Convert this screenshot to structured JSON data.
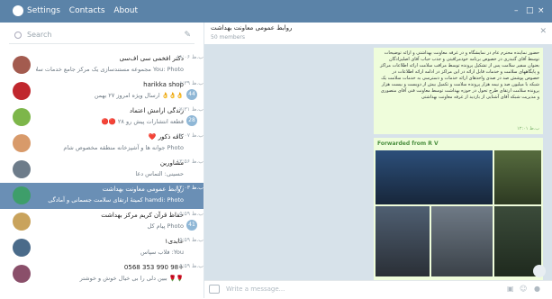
{
  "menu": [
    "Settings",
    "Contacts",
    "About"
  ],
  "window_controls": [
    "–",
    "□",
    "×"
  ],
  "search": {
    "placeholder": "Search"
  },
  "chats": [
    {
      "title": "دکتر افخمی سی اف‌سی",
      "preview": "You: Photo مجموعه مستندسازی یک مرکز جامع خدمات سلامت",
      "time": "۱۸:۰۶ ب.ظ",
      "badge": "",
      "avatar_color": "#a35b4f",
      "active": false
    },
    {
      "title": "harikka shop",
      "preview": "👌👌👌 ارسال ویژه امروز ۲۷ بهمن",
      "time": "۰۸:۳۹ ب.ظ",
      "badge": "44",
      "avatar_color": "#c0272d",
      "active": false
    },
    {
      "title": "زندگی ارامش اعتماد",
      "preview": "قطعه انتشارات پیش رو ۲۸ 🔴🔴",
      "time": "۰۷:۳۱ ب.ظ",
      "badge": "28",
      "avatar_color": "#7db64a",
      "active": false
    },
    {
      "title": "کافه ذکور ❤️",
      "preview": "Photo جوانه ها و آشپزخانه منطقه مخصوص شام",
      "time": "۱۸:۰۷ ب.ظ",
      "badge": "",
      "avatar_color": "#d89a6a",
      "active": false
    },
    {
      "title": "مشاورین",
      "preview": "حسینی: التماس دعا",
      "time": "۱۳:۵۶ ب.ظ",
      "badge": "",
      "avatar_color": "#6d7c8a",
      "active": false
    },
    {
      "title": "روابط عمومی معاونت بهداشت",
      "preview": "hamdi: Photo کمیتهٔ ارتقای سلامت جسمانی و آمادگی",
      "time": "۱۲:۰۳ ب.ظ",
      "badge": "",
      "avatar_color": "#3e9e6a",
      "active": true
    },
    {
      "title": "حفاظ قرآن کریم مرکز بهداشت",
      "preview": "Photo پیام کل",
      "time": "۰۵:۵۹ ب.ظ",
      "badge": "41",
      "avatar_color": "#c9a35c",
      "active": false
    },
    {
      "title": "عابدی۱",
      "preview": "You: فلاب سپاس",
      "time": "۰۵:۵۹ ب.ظ",
      "badge": "",
      "avatar_color": "#4a6b8a",
      "active": false
    },
    {
      "title": "+98 990 353 0568",
      "preview": "🌹🌹 ببین دلی را بی خیال خوش و خوشتر",
      "time": "۰۵:۵۹ ب.ظ",
      "badge": "",
      "avatar_color": "#8a4f6a",
      "active": false
    }
  ],
  "header": {
    "title": "روابط عمومی معاونت بهداشت",
    "subtitle": "50 members"
  },
  "message": {
    "text": "حضور نماینده محترم عام در نمایشگاه و در غرفه معاونت بهداشتی و ارائه توضیحات توسط آقای گنبدری در خصوص برنامه خودمراقبتی و جذب حباب آقای اصلیزادگان بعنوان سفیر سلامت پس از تشکیل پرونده توسط مراقب سلامت ارائه اطلاعات مراکز و پایگاههای سلامت و خدمات قابل ارائه در این مراکز در ادامه ارائه اطلاعات در خصوص پوشش صد در صدی واحدهای ارائه خدمات و دسترسی به خدمات سلامت یک شبکه با میلیون صد و نیمه هزار پرونده سلامت و تکمیل بیش از دویست و بیست هزار پرونده سلامت ارتقای طرح تحول در حوزه بهداشت توسط معاونت فنی آقای منصوری و مدیریت شبکه آقای آشنایی از بازدید از غرفه معاونت بهداشتی",
    "time": "۱۲:۰۱ ب.ظ",
    "forwarded_label": "Forwarded from R V"
  },
  "compose": {
    "placeholder": "Write a message..."
  },
  "colors": {
    "topbar": "#5b83a8",
    "active_chat": "#6a8fb5",
    "bubble": "#effddb",
    "chat_bg": "#d7e2ea"
  }
}
